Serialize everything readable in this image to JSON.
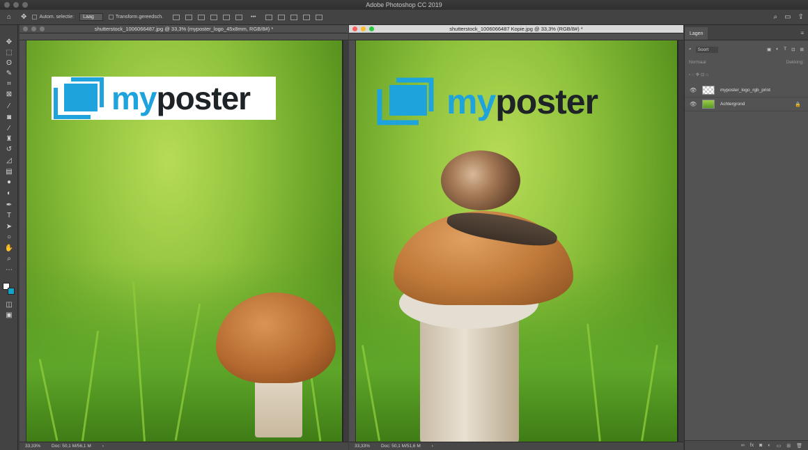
{
  "app": {
    "title": "Adobe Photoshop CC 2019"
  },
  "options_bar": {
    "auto_select_label": "Autom. selectie:",
    "auto_select_value": "Laag",
    "transform_label": "Transform.gereedsch.",
    "more_label": "•••"
  },
  "documents": [
    {
      "title": "shutterstock_1006066487.jpg @ 33,3% (myposter_logo_45x8mm, RGB/8#) *",
      "zoom": "33,33%",
      "doc_info": "Doc: 50,1 M/56,1 M",
      "logo_my": "my",
      "logo_poster": "poster"
    },
    {
      "title": "shutterstock_1006066487 Kopie.jpg @ 33,3% (RGB/8#) *",
      "zoom": "33,33%",
      "doc_info": "Doc: 50,1 M/51,6 M",
      "logo_my": "my",
      "logo_poster": "poster"
    }
  ],
  "layers_panel": {
    "tab": "Lagen",
    "filter": "Soort",
    "blend_mode": "Normaal",
    "opacity_label": "Dekking:",
    "layers": [
      {
        "name": "myposter_logo_rgb_print"
      },
      {
        "name": "Achtergrond"
      }
    ]
  }
}
